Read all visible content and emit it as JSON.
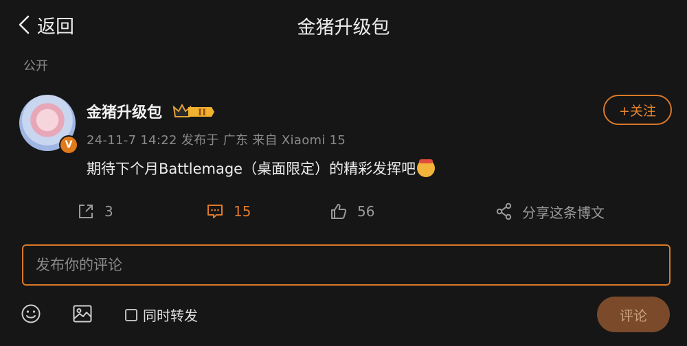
{
  "header": {
    "back_label": "返回",
    "title": "金猪升级包"
  },
  "visibility": "公开",
  "post": {
    "username": "金猪升级包",
    "verified_badge": "V",
    "crown_level": "II",
    "meta": "24-11-7 14:22  发布于 广东  来自 Xiaomi 15",
    "content": "期待下个月Battlemage（桌面限定）的精彩发挥吧",
    "follow_label": "+关注"
  },
  "actions": {
    "repost_count": "3",
    "comment_count": "15",
    "like_count": "56",
    "share_label": "分享这条博文"
  },
  "comment": {
    "placeholder": "发布你的评论"
  },
  "toolbar": {
    "repost_label": "同时转发",
    "submit_label": "评论"
  },
  "colors": {
    "accent": "#e07a2a",
    "background": "#161616",
    "submit_bg": "#7a4a2b"
  }
}
